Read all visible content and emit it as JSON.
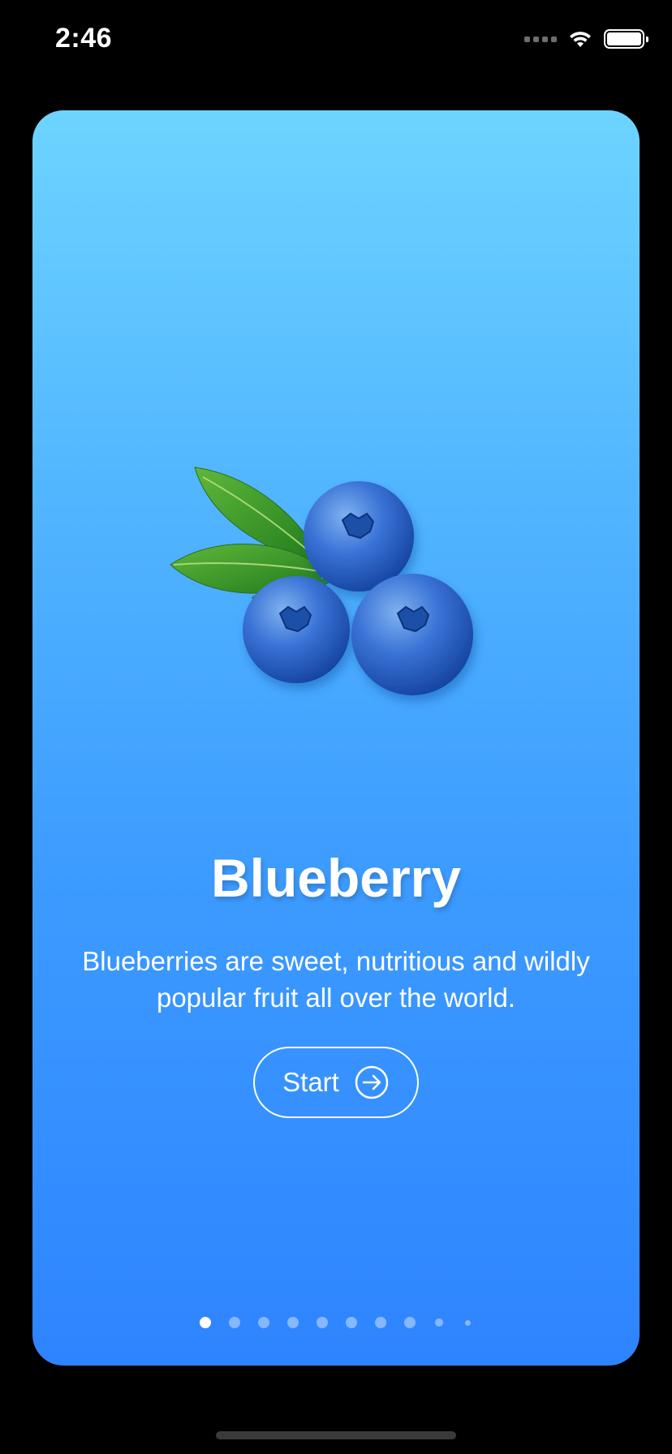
{
  "status_bar": {
    "time": "2:46",
    "icons": [
      "cellular-icon",
      "wifi-icon",
      "battery-icon"
    ]
  },
  "card": {
    "title": "Blueberry",
    "description": "Blueberries are sweet, nutritious and wildly popular fruit all over the world.",
    "start_label": "Start",
    "start_icon": "arrow-right-circle-icon",
    "image": "blueberries-image",
    "gradient_top": "#6dd4ff",
    "gradient_bottom": "#2e84ff"
  },
  "page_indicator": {
    "total": 10,
    "current": 1
  }
}
